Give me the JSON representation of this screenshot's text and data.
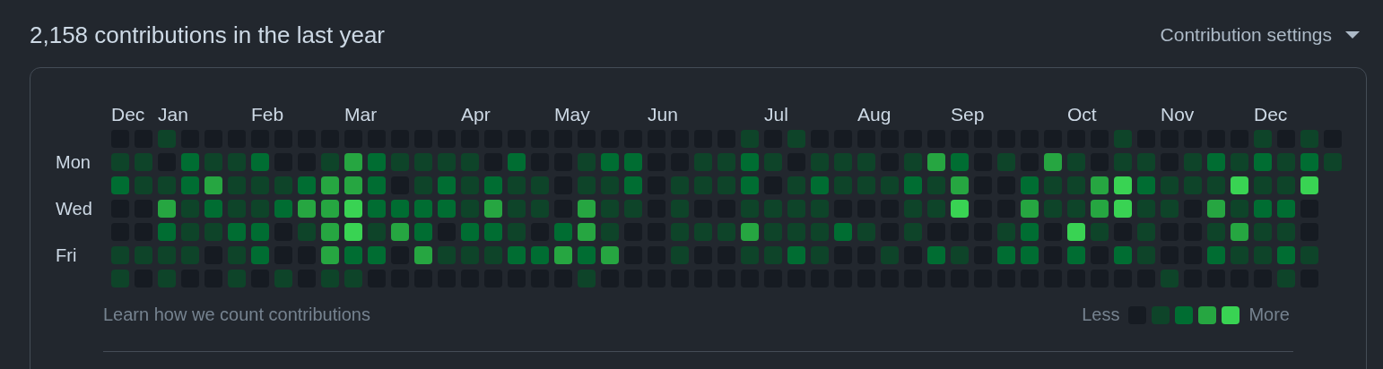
{
  "header": {
    "title": "2,158 contributions in the last year",
    "settings": "Contribution settings"
  },
  "day_labels": [
    "Mon",
    "Wed",
    "Fri"
  ],
  "weeks": [
    {
      "month": "Dec",
      "days": [
        {
          "color": "#161b22"
        },
        {
          "color": "#0e4429"
        },
        {
          "color": "#006d32"
        },
        {
          "color": "#161b22"
        },
        {
          "color": "#161b22"
        },
        {
          "color": "#0e4429"
        },
        {
          "color": "#0e4429"
        }
      ]
    },
    {
      "days": [
        {
          "color": "#161b22"
        },
        {
          "color": "#0e4429"
        },
        {
          "color": "#0e4429"
        },
        {
          "color": "#161b22"
        },
        {
          "color": "#161b22"
        },
        {
          "color": "#0e4429"
        },
        {
          "color": "#161b22"
        }
      ]
    },
    {
      "month": "Jan",
      "days": [
        {
          "color": "#0e4429"
        },
        {
          "color": "#161b22"
        },
        {
          "color": "#0e4429"
        },
        {
          "color": "#26a641"
        },
        {
          "color": "#006d32"
        },
        {
          "color": "#0e4429"
        },
        {
          "color": "#0e4429"
        }
      ]
    },
    {
      "days": [
        {
          "color": "#161b22"
        },
        {
          "color": "#006d32"
        },
        {
          "color": "#006d32"
        },
        {
          "color": "#0e4429"
        },
        {
          "color": "#0e4429"
        },
        {
          "color": "#0e4429"
        },
        {
          "color": "#161b22"
        }
      ]
    },
    {
      "days": [
        {
          "color": "#161b22"
        },
        {
          "color": "#0e4429"
        },
        {
          "color": "#26a641"
        },
        {
          "color": "#006d32"
        },
        {
          "color": "#0e4429"
        },
        {
          "color": "#161b22"
        },
        {
          "color": "#161b22"
        }
      ]
    },
    {
      "days": [
        {
          "color": "#161b22"
        },
        {
          "color": "#0e4429"
        },
        {
          "color": "#0e4429"
        },
        {
          "color": "#0e4429"
        },
        {
          "color": "#006d32"
        },
        {
          "color": "#0e4429"
        },
        {
          "color": "#0e4429"
        }
      ]
    },
    {
      "month": "Feb",
      "days": [
        {
          "color": "#161b22"
        },
        {
          "color": "#006d32"
        },
        {
          "color": "#0e4429"
        },
        {
          "color": "#0e4429"
        },
        {
          "color": "#006d32"
        },
        {
          "color": "#006d32"
        },
        {
          "color": "#161b22"
        }
      ]
    },
    {
      "days": [
        {
          "color": "#161b22"
        },
        {
          "color": "#161b22"
        },
        {
          "color": "#0e4429"
        },
        {
          "color": "#006d32"
        },
        {
          "color": "#161b22"
        },
        {
          "color": "#161b22"
        },
        {
          "color": "#0e4429"
        }
      ]
    },
    {
      "days": [
        {
          "color": "#161b22"
        },
        {
          "color": "#161b22"
        },
        {
          "color": "#006d32"
        },
        {
          "color": "#26a641"
        },
        {
          "color": "#0e4429"
        },
        {
          "color": "#161b22"
        },
        {
          "color": "#161b22"
        }
      ]
    },
    {
      "days": [
        {
          "color": "#161b22"
        },
        {
          "color": "#0e4429"
        },
        {
          "color": "#26a641"
        },
        {
          "color": "#26a641"
        },
        {
          "color": "#26a641"
        },
        {
          "color": "#26a641"
        },
        {
          "color": "#0e4429"
        }
      ]
    },
    {
      "month": "Mar",
      "days": [
        {
          "color": "#161b22"
        },
        {
          "color": "#26a641"
        },
        {
          "color": "#26a641"
        },
        {
          "color": "#39d353"
        },
        {
          "color": "#39d353"
        },
        {
          "color": "#006d32"
        },
        {
          "color": "#0e4429"
        }
      ]
    },
    {
      "days": [
        {
          "color": "#161b22"
        },
        {
          "color": "#006d32"
        },
        {
          "color": "#006d32"
        },
        {
          "color": "#006d32"
        },
        {
          "color": "#0e4429"
        },
        {
          "color": "#006d32"
        },
        {
          "color": "#161b22"
        }
      ]
    },
    {
      "days": [
        {
          "color": "#161b22"
        },
        {
          "color": "#0e4429"
        },
        {
          "color": "#161b22"
        },
        {
          "color": "#006d32"
        },
        {
          "color": "#26a641"
        },
        {
          "color": "#161b22"
        },
        {
          "color": "#161b22"
        }
      ]
    },
    {
      "days": [
        {
          "color": "#161b22"
        },
        {
          "color": "#0e4429"
        },
        {
          "color": "#0e4429"
        },
        {
          "color": "#006d32"
        },
        {
          "color": "#006d32"
        },
        {
          "color": "#26a641"
        },
        {
          "color": "#161b22"
        }
      ]
    },
    {
      "days": [
        {
          "color": "#161b22"
        },
        {
          "color": "#0e4429"
        },
        {
          "color": "#006d32"
        },
        {
          "color": "#006d32"
        },
        {
          "color": "#161b22"
        },
        {
          "color": "#0e4429"
        },
        {
          "color": "#161b22"
        }
      ]
    },
    {
      "month": "Apr",
      "days": [
        {
          "color": "#161b22"
        },
        {
          "color": "#0e4429"
        },
        {
          "color": "#0e4429"
        },
        {
          "color": "#0e4429"
        },
        {
          "color": "#006d32"
        },
        {
          "color": "#0e4429"
        },
        {
          "color": "#161b22"
        }
      ]
    },
    {
      "days": [
        {
          "color": "#161b22"
        },
        {
          "color": "#161b22"
        },
        {
          "color": "#006d32"
        },
        {
          "color": "#26a641"
        },
        {
          "color": "#006d32"
        },
        {
          "color": "#0e4429"
        },
        {
          "color": "#161b22"
        }
      ]
    },
    {
      "days": [
        {
          "color": "#161b22"
        },
        {
          "color": "#006d32"
        },
        {
          "color": "#0e4429"
        },
        {
          "color": "#0e4429"
        },
        {
          "color": "#0e4429"
        },
        {
          "color": "#006d32"
        },
        {
          "color": "#161b22"
        }
      ]
    },
    {
      "days": [
        {
          "color": "#161b22"
        },
        {
          "color": "#161b22"
        },
        {
          "color": "#0e4429"
        },
        {
          "color": "#0e4429"
        },
        {
          "color": "#161b22"
        },
        {
          "color": "#006d32"
        },
        {
          "color": "#161b22"
        }
      ]
    },
    {
      "month": "May",
      "days": [
        {
          "color": "#161b22"
        },
        {
          "color": "#161b22"
        },
        {
          "color": "#161b22"
        },
        {
          "color": "#161b22"
        },
        {
          "color": "#006d32"
        },
        {
          "color": "#26a641"
        },
        {
          "color": "#161b22"
        }
      ]
    },
    {
      "days": [
        {
          "color": "#161b22"
        },
        {
          "color": "#0e4429"
        },
        {
          "color": "#0e4429"
        },
        {
          "color": "#26a641"
        },
        {
          "color": "#26a641"
        },
        {
          "color": "#006d32"
        },
        {
          "color": "#0e4429"
        }
      ]
    },
    {
      "days": [
        {
          "color": "#161b22"
        },
        {
          "color": "#006d32"
        },
        {
          "color": "#0e4429"
        },
        {
          "color": "#0e4429"
        },
        {
          "color": "#0e4429"
        },
        {
          "color": "#26a641"
        },
        {
          "color": "#161b22"
        }
      ]
    },
    {
      "days": [
        {
          "color": "#161b22"
        },
        {
          "color": "#006d32"
        },
        {
          "color": "#006d32"
        },
        {
          "color": "#0e4429"
        },
        {
          "color": "#161b22"
        },
        {
          "color": "#161b22"
        },
        {
          "color": "#161b22"
        }
      ]
    },
    {
      "month": "Jun",
      "days": [
        {
          "color": "#161b22"
        },
        {
          "color": "#161b22"
        },
        {
          "color": "#161b22"
        },
        {
          "color": "#161b22"
        },
        {
          "color": "#161b22"
        },
        {
          "color": "#161b22"
        },
        {
          "color": "#161b22"
        }
      ]
    },
    {
      "days": [
        {
          "color": "#161b22"
        },
        {
          "color": "#161b22"
        },
        {
          "color": "#0e4429"
        },
        {
          "color": "#0e4429"
        },
        {
          "color": "#0e4429"
        },
        {
          "color": "#0e4429"
        },
        {
          "color": "#161b22"
        }
      ]
    },
    {
      "days": [
        {
          "color": "#161b22"
        },
        {
          "color": "#0e4429"
        },
        {
          "color": "#0e4429"
        },
        {
          "color": "#161b22"
        },
        {
          "color": "#0e4429"
        },
        {
          "color": "#161b22"
        },
        {
          "color": "#161b22"
        }
      ]
    },
    {
      "days": [
        {
          "color": "#161b22"
        },
        {
          "color": "#0e4429"
        },
        {
          "color": "#0e4429"
        },
        {
          "color": "#161b22"
        },
        {
          "color": "#0e4429"
        },
        {
          "color": "#161b22"
        },
        {
          "color": "#161b22"
        }
      ]
    },
    {
      "days": [
        {
          "color": "#0e4429"
        },
        {
          "color": "#006d32"
        },
        {
          "color": "#006d32"
        },
        {
          "color": "#0e4429"
        },
        {
          "color": "#26a641"
        },
        {
          "color": "#0e4429"
        },
        {
          "color": "#161b22"
        }
      ]
    },
    {
      "month": "Jul",
      "days": [
        {
          "color": "#161b22"
        },
        {
          "color": "#0e4429"
        },
        {
          "color": "#161b22"
        },
        {
          "color": "#0e4429"
        },
        {
          "color": "#0e4429"
        },
        {
          "color": "#0e4429"
        },
        {
          "color": "#161b22"
        }
      ]
    },
    {
      "days": [
        {
          "color": "#0e4429"
        },
        {
          "color": "#161b22"
        },
        {
          "color": "#0e4429"
        },
        {
          "color": "#0e4429"
        },
        {
          "color": "#0e4429"
        },
        {
          "color": "#006d32"
        },
        {
          "color": "#161b22"
        }
      ]
    },
    {
      "days": [
        {
          "color": "#161b22"
        },
        {
          "color": "#0e4429"
        },
        {
          "color": "#006d32"
        },
        {
          "color": "#0e4429"
        },
        {
          "color": "#0e4429"
        },
        {
          "color": "#0e4429"
        },
        {
          "color": "#161b22"
        }
      ]
    },
    {
      "days": [
        {
          "color": "#161b22"
        },
        {
          "color": "#0e4429"
        },
        {
          "color": "#0e4429"
        },
        {
          "color": "#161b22"
        },
        {
          "color": "#006d32"
        },
        {
          "color": "#161b22"
        },
        {
          "color": "#161b22"
        }
      ]
    },
    {
      "month": "Aug",
      "days": [
        {
          "color": "#161b22"
        },
        {
          "color": "#0e4429"
        },
        {
          "color": "#0e4429"
        },
        {
          "color": "#161b22"
        },
        {
          "color": "#0e4429"
        },
        {
          "color": "#161b22"
        },
        {
          "color": "#161b22"
        }
      ]
    },
    {
      "days": [
        {
          "color": "#161b22"
        },
        {
          "color": "#161b22"
        },
        {
          "color": "#0e4429"
        },
        {
          "color": "#161b22"
        },
        {
          "color": "#161b22"
        },
        {
          "color": "#0e4429"
        },
        {
          "color": "#161b22"
        }
      ]
    },
    {
      "days": [
        {
          "color": "#161b22"
        },
        {
          "color": "#0e4429"
        },
        {
          "color": "#006d32"
        },
        {
          "color": "#0e4429"
        },
        {
          "color": "#0e4429"
        },
        {
          "color": "#161b22"
        },
        {
          "color": "#161b22"
        }
      ]
    },
    {
      "days": [
        {
          "color": "#161b22"
        },
        {
          "color": "#26a641"
        },
        {
          "color": "#0e4429"
        },
        {
          "color": "#0e4429"
        },
        {
          "color": "#161b22"
        },
        {
          "color": "#006d32"
        },
        {
          "color": "#161b22"
        }
      ]
    },
    {
      "month": "Sep",
      "days": [
        {
          "color": "#161b22"
        },
        {
          "color": "#006d32"
        },
        {
          "color": "#26a641"
        },
        {
          "color": "#39d353"
        },
        {
          "color": "#161b22"
        },
        {
          "color": "#0e4429"
        },
        {
          "color": "#161b22"
        }
      ]
    },
    {
      "days": [
        {
          "color": "#161b22"
        },
        {
          "color": "#161b22"
        },
        {
          "color": "#161b22"
        },
        {
          "color": "#161b22"
        },
        {
          "color": "#161b22"
        },
        {
          "color": "#161b22"
        },
        {
          "color": "#161b22"
        }
      ]
    },
    {
      "days": [
        {
          "color": "#161b22"
        },
        {
          "color": "#0e4429"
        },
        {
          "color": "#161b22"
        },
        {
          "color": "#161b22"
        },
        {
          "color": "#0e4429"
        },
        {
          "color": "#006d32"
        },
        {
          "color": "#161b22"
        }
      ]
    },
    {
      "days": [
        {
          "color": "#161b22"
        },
        {
          "color": "#161b22"
        },
        {
          "color": "#006d32"
        },
        {
          "color": "#26a641"
        },
        {
          "color": "#006d32"
        },
        {
          "color": "#006d32"
        },
        {
          "color": "#161b22"
        }
      ]
    },
    {
      "days": [
        {
          "color": "#161b22"
        },
        {
          "color": "#26a641"
        },
        {
          "color": "#0e4429"
        },
        {
          "color": "#0e4429"
        },
        {
          "color": "#161b22"
        },
        {
          "color": "#161b22"
        },
        {
          "color": "#161b22"
        }
      ]
    },
    {
      "month": "Oct",
      "days": [
        {
          "color": "#161b22"
        },
        {
          "color": "#0e4429"
        },
        {
          "color": "#0e4429"
        },
        {
          "color": "#0e4429"
        },
        {
          "color": "#39d353"
        },
        {
          "color": "#006d32"
        },
        {
          "color": "#161b22"
        }
      ]
    },
    {
      "days": [
        {
          "color": "#161b22"
        },
        {
          "color": "#161b22"
        },
        {
          "color": "#26a641"
        },
        {
          "color": "#26a641"
        },
        {
          "color": "#0e4429"
        },
        {
          "color": "#161b22"
        },
        {
          "color": "#161b22"
        }
      ]
    },
    {
      "days": [
        {
          "color": "#0e4429"
        },
        {
          "color": "#0e4429"
        },
        {
          "color": "#39d353"
        },
        {
          "color": "#39d353"
        },
        {
          "color": "#161b22"
        },
        {
          "color": "#006d32"
        },
        {
          "color": "#161b22"
        }
      ]
    },
    {
      "days": [
        {
          "color": "#161b22"
        },
        {
          "color": "#0e4429"
        },
        {
          "color": "#006d32"
        },
        {
          "color": "#0e4429"
        },
        {
          "color": "#0e4429"
        },
        {
          "color": "#0e4429"
        },
        {
          "color": "#161b22"
        }
      ]
    },
    {
      "month": "Nov",
      "days": [
        {
          "color": "#161b22"
        },
        {
          "color": "#161b22"
        },
        {
          "color": "#0e4429"
        },
        {
          "color": "#0e4429"
        },
        {
          "color": "#161b22"
        },
        {
          "color": "#161b22"
        },
        {
          "color": "#0e4429"
        }
      ]
    },
    {
      "days": [
        {
          "color": "#161b22"
        },
        {
          "color": "#0e4429"
        },
        {
          "color": "#0e4429"
        },
        {
          "color": "#161b22"
        },
        {
          "color": "#161b22"
        },
        {
          "color": "#161b22"
        },
        {
          "color": "#161b22"
        }
      ]
    },
    {
      "days": [
        {
          "color": "#161b22"
        },
        {
          "color": "#006d32"
        },
        {
          "color": "#0e4429"
        },
        {
          "color": "#26a641"
        },
        {
          "color": "#0e4429"
        },
        {
          "color": "#006d32"
        },
        {
          "color": "#161b22"
        }
      ]
    },
    {
      "days": [
        {
          "color": "#161b22"
        },
        {
          "color": "#0e4429"
        },
        {
          "color": "#39d353"
        },
        {
          "color": "#0e4429"
        },
        {
          "color": "#26a641"
        },
        {
          "color": "#0e4429"
        },
        {
          "color": "#161b22"
        }
      ]
    },
    {
      "month": "Dec",
      "days": [
        {
          "color": "#0e4429"
        },
        {
          "color": "#006d32"
        },
        {
          "color": "#0e4429"
        },
        {
          "color": "#006d32"
        },
        {
          "color": "#0e4429"
        },
        {
          "color": "#0e4429"
        },
        {
          "color": "#161b22"
        }
      ]
    },
    {
      "days": [
        {
          "color": "#161b22"
        },
        {
          "color": "#0e4429"
        },
        {
          "color": "#0e4429"
        },
        {
          "color": "#006d32"
        },
        {
          "color": "#0e4429"
        },
        {
          "color": "#006d32"
        },
        {
          "color": "#0e4429"
        }
      ]
    },
    {
      "days": [
        {
          "color": "#0e4429"
        },
        {
          "color": "#006d32"
        },
        {
          "color": "#39d353"
        },
        {
          "color": "#161b22"
        },
        {
          "color": "#161b22"
        },
        {
          "color": "#0e4429"
        },
        {
          "color": "#161b22"
        }
      ]
    },
    {
      "days": [
        {
          "color": "#161b22"
        },
        {
          "color": "#0e4429"
        }
      ]
    }
  ],
  "footer": {
    "link": "Learn how we count contributions",
    "less": "Less",
    "more": "More",
    "legend": [
      {
        "color": "#161b22"
      },
      {
        "color": "#0e4429"
      },
      {
        "color": "#006d32"
      },
      {
        "color": "#26a641"
      },
      {
        "color": "#39d353"
      }
    ]
  }
}
